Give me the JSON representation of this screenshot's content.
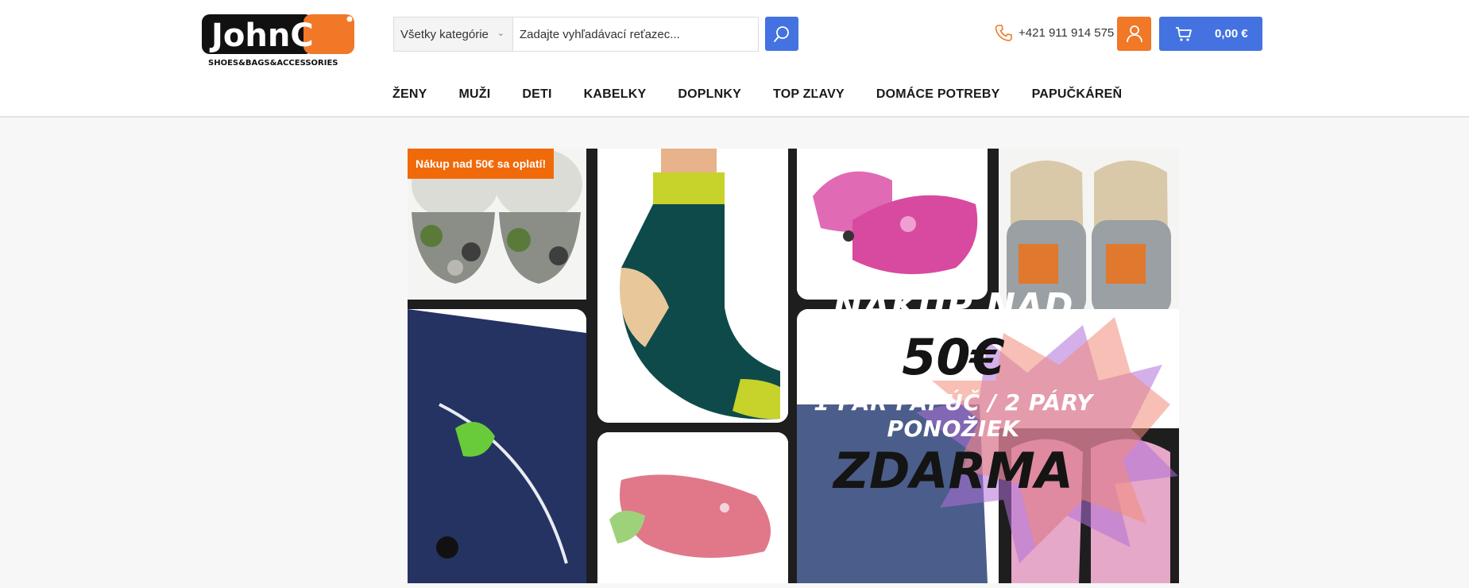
{
  "header": {
    "logo_text": "JohnC",
    "logo_tagline": "SHOES&BAGS&ACCESSORIES",
    "search": {
      "category_label": "Všetky kategórie",
      "placeholder": "Zadajte vyhľadávací reťazec..."
    },
    "phone": "+421 911 914 575",
    "cart_price": "0,00  €"
  },
  "nav": {
    "items": [
      "ŽENY",
      "MUŽI",
      "DETI",
      "KABELKY",
      "DOPLNKY",
      "TOP ZĽAVY",
      "DOMÁCE POTREBY",
      "PAPUČKÁREŇ"
    ]
  },
  "banner": {
    "badge": "Nákup nad 50€ sa oplatí!",
    "line1": "NÁKUP NAD",
    "line2": "50€",
    "line3": "1 PÁR PAPÚČ / 2 PÁRY PONOŽIEK",
    "line4": "ZDARMA"
  },
  "colors": {
    "accent_blue": "#4472e0",
    "accent_orange": "#f07826",
    "badge_orange": "#f06a0a"
  }
}
